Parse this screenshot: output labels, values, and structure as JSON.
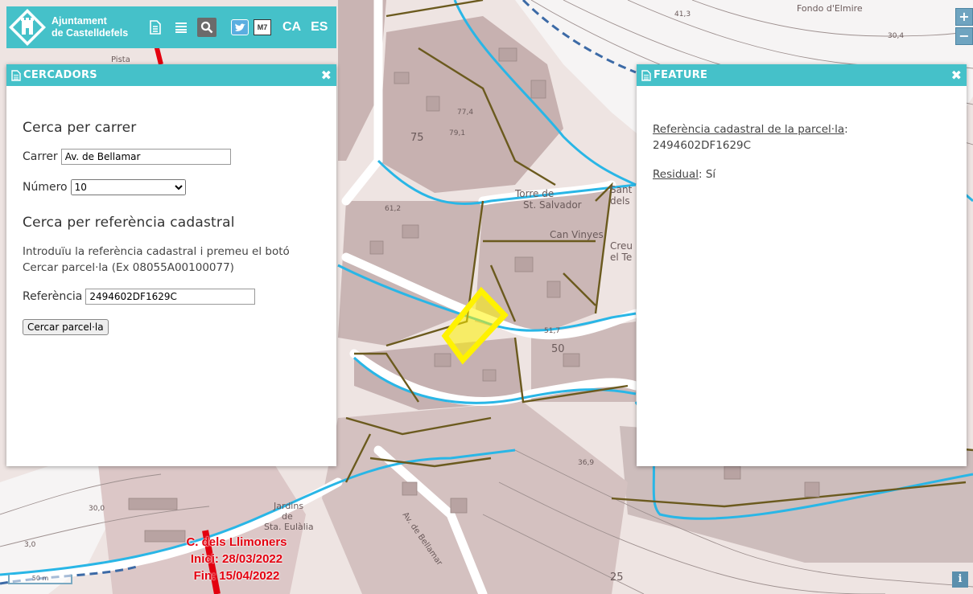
{
  "brand": {
    "line1": "Ajuntament",
    "line2": "de Castelldefels"
  },
  "toolbar": {
    "doc_icon": "document-icon",
    "layers_icon": "layers-icon",
    "search_icon": "search-icon",
    "twitter_icon": "twitter-icon",
    "m7_label": "M7",
    "lang_ca": "CA",
    "lang_es": "ES"
  },
  "zoom": {
    "in": "+",
    "out": "−"
  },
  "info_label": "i",
  "scale_label": "50 m",
  "cercadors": {
    "title": "CERCADORS",
    "street_heading": "Cerca per carrer",
    "street_label": "Carrer",
    "street_value": "Av. de Bellamar",
    "number_label": "Número",
    "number_value": "10",
    "cadastral_heading": "Cerca per referència cadastral",
    "intro": "Introduïu la referència cadastral i premeu el botó Cercar parcel·la (Ex 08055A00100077)",
    "ref_label": "Referència",
    "ref_value": "2494602DF1629C",
    "search_button": "Cercar parcel·la"
  },
  "feature": {
    "title": "FEATURE",
    "ref_label": "Referència cadastral de la parcel·la",
    "ref_value": "2494602DF1629C",
    "residual_label": "Residual",
    "residual_value": "Sí"
  },
  "roadwork": {
    "street": "C. dels Llimoners",
    "start": "Inici: 28/03/2022",
    "end": "Fin: 15/04/2022"
  },
  "map_labels": {
    "torre_1": "Torre de",
    "torre_2": "St. Salvador",
    "can_vinyes": "Can Vinyes",
    "creu_1": "Creu",
    "creu_2": "el Te",
    "sant_1": "Sant",
    "sant_2": "dels",
    "jardins_1": "Jardins",
    "jardins_2": "de",
    "jardins_3": "Sta. Eulàlia",
    "bellamar": "Av. de Bellamar",
    "fondo": "Fondo d'Elmire",
    "n50": "50",
    "n75": "75",
    "n25": "25",
    "pista": "Pista",
    "e41_3": "41,3",
    "e30_4": "30,4",
    "e79_1": "79,1",
    "e77_4": "77,4",
    "e61_2": "61,2",
    "e51_7": "51,7",
    "e36_9": "36,9",
    "e30_0": "30,0",
    "e3_0": "3,0"
  },
  "colors": {
    "accent": "#45c1c9",
    "highlight": "#fff200",
    "roadwork": "#e3000f",
    "stream": "#29b6e6",
    "parcel_border": "#6b5a1e"
  }
}
